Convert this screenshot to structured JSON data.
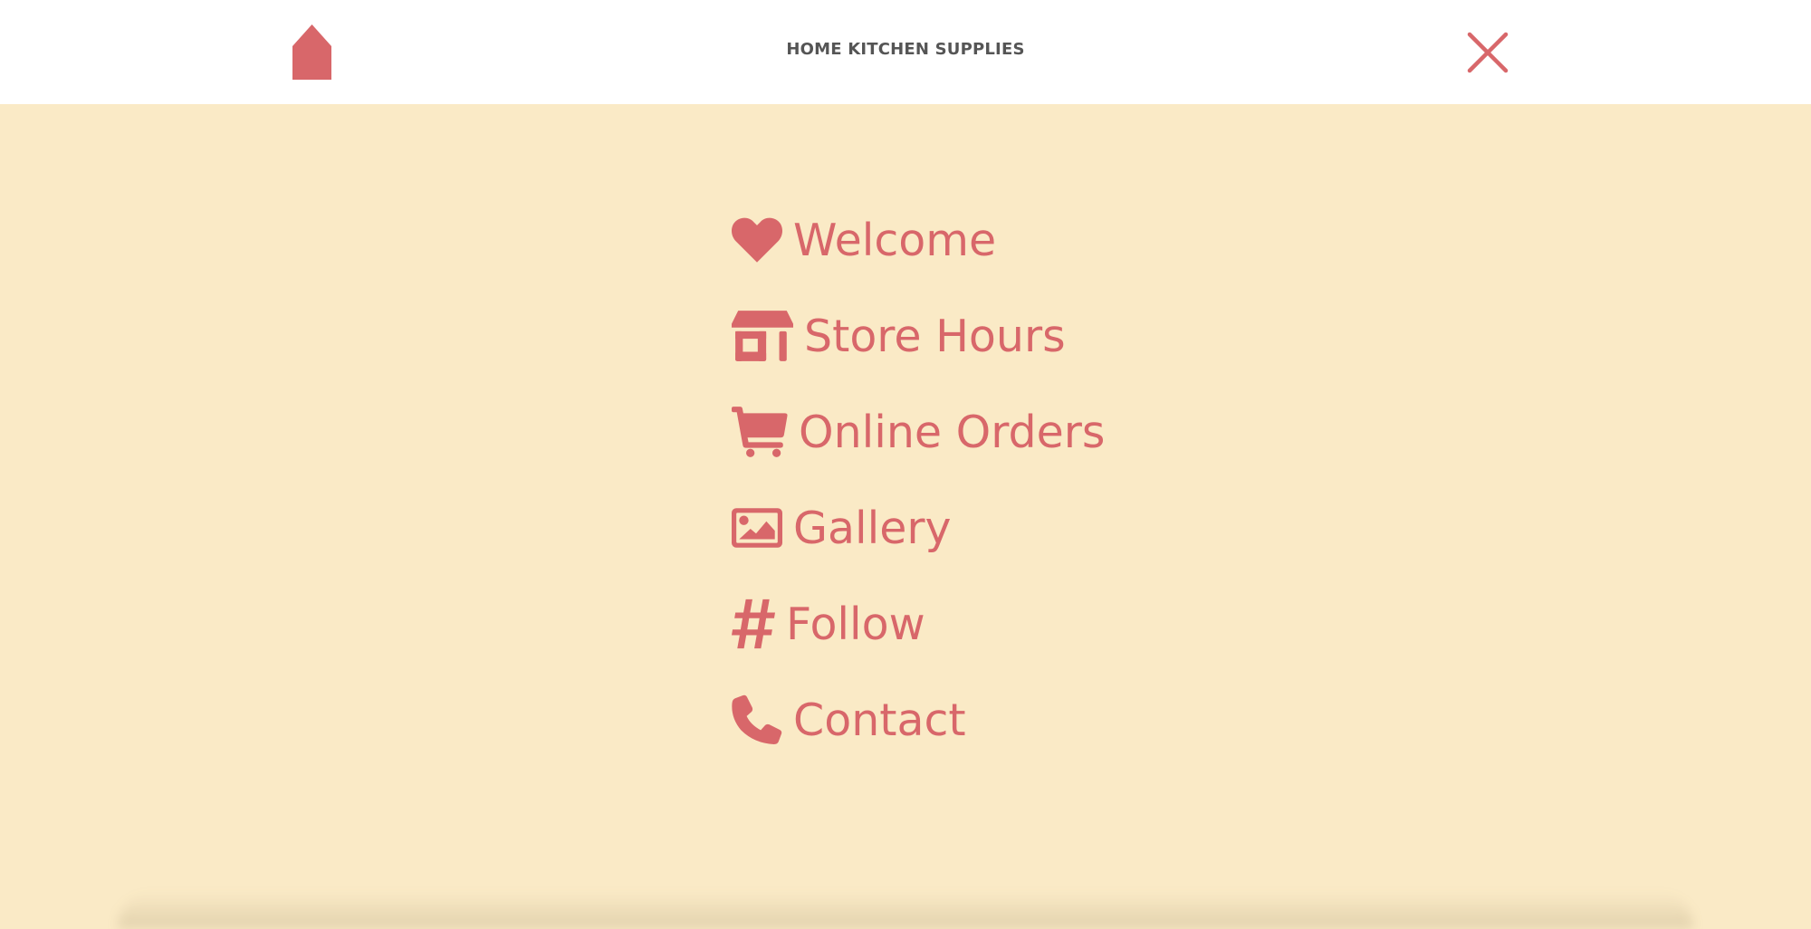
{
  "header": {
    "title": "HOME KITCHEN SUPPLIES",
    "home_icon": "home-icon",
    "close_icon": "close-icon"
  },
  "menu": {
    "items": [
      {
        "label": "Welcome",
        "icon": "heart-icon"
      },
      {
        "label": "Store Hours",
        "icon": "store-icon"
      },
      {
        "label": "Online Orders",
        "icon": "cart-icon"
      },
      {
        "label": "Gallery",
        "icon": "image-icon"
      },
      {
        "label": "Follow",
        "icon": "hashtag-icon"
      },
      {
        "label": "Contact",
        "icon": "phone-icon"
      }
    ]
  },
  "colors": {
    "background": "#faeac6",
    "header_background": "#ffffff",
    "accent": "#d8676a",
    "title_text": "#555555"
  }
}
